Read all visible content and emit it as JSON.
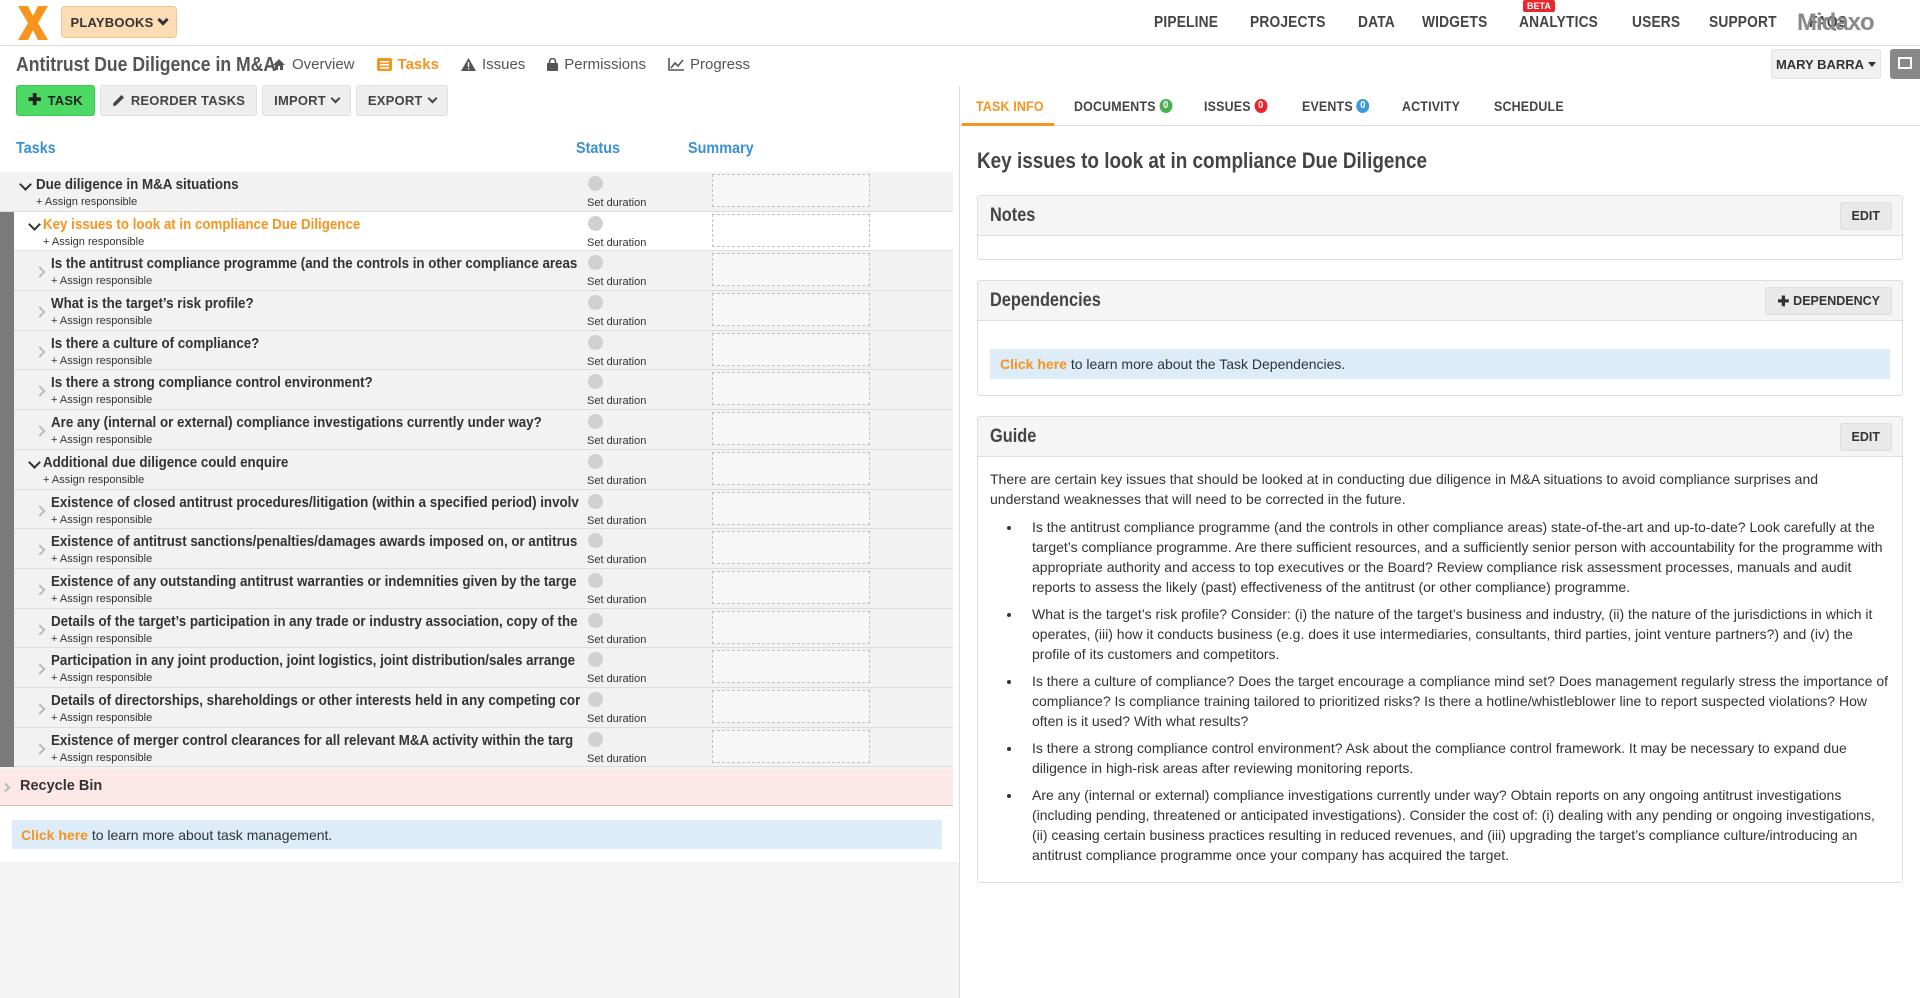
{
  "topnav": {
    "playbooks_label": "PLAYBOOKS",
    "links": [
      "PIPELINE",
      "PROJECTS",
      "DATA",
      "WIDGETS",
      "ANALYTICS",
      "USERS",
      "SUPPORT",
      "FAQS"
    ],
    "beta_label": "BETA",
    "brand": "Midaxo",
    "accent_color": "#f7941d"
  },
  "project": {
    "title": "Antitrust Due Diligence in M&A",
    "tabs": [
      {
        "label": "Overview",
        "icon": "home-icon"
      },
      {
        "label": "Tasks",
        "icon": "list-icon",
        "active": true
      },
      {
        "label": "Issues",
        "icon": "warning-icon"
      },
      {
        "label": "Permissions",
        "icon": "lock-icon"
      },
      {
        "label": "Progress",
        "icon": "line-chart-icon"
      }
    ],
    "user_label": "MARY BARRA"
  },
  "toolbar": {
    "task_label": "TASK",
    "reorder_label": "REORDER TASKS",
    "import_label": "IMPORT",
    "export_label": "EXPORT"
  },
  "table": {
    "col_tasks": "Tasks",
    "col_status": "Status",
    "col_summary": "Summary",
    "assign_label": "+ Assign responsible",
    "duration_label": "Set duration",
    "rows": [
      {
        "title": "Due diligence in M&A situations",
        "level": 0,
        "expanded": true
      },
      {
        "title": "Key issues to look at in compliance Due Diligence",
        "level": 1,
        "expanded": true,
        "selected": true
      },
      {
        "title": "Is the antitrust compliance programme (and the controls in other compliance areas",
        "level": 2
      },
      {
        "title": "What is the target’s risk profile?",
        "level": 2
      },
      {
        "title": "Is there a culture of compliance?",
        "level": 2
      },
      {
        "title": "Is there a strong compliance control environment?",
        "level": 2
      },
      {
        "title": "Are any (internal or external) compliance investigations currently under way?",
        "level": 2
      },
      {
        "title": "Additional due diligence could enquire",
        "level": 1,
        "expanded": true
      },
      {
        "title": "Existence of closed antitrust procedures/litigation (within a specified period) involv",
        "level": 2
      },
      {
        "title": "Existence of antitrust sanctions/penalties/damages awards imposed on, or antitrus",
        "level": 2
      },
      {
        "title": "Existence of any outstanding antitrust warranties or indemnities given by the targe",
        "level": 2
      },
      {
        "title": "Details of the target’s participation in any trade or industry association, copy of the",
        "level": 2
      },
      {
        "title": "Participation in any joint production, joint logistics, joint distribution/sales arrange",
        "level": 2
      },
      {
        "title": "Details of directorships, shareholdings or other interests held in any competing cor",
        "level": 2
      },
      {
        "title": "Existence of merger control clearances for all relevant M&A activity within the targ",
        "level": 2
      }
    ],
    "recycle_label": "Recycle Bin",
    "info_link": "Click here",
    "info_text": " to learn more about task management."
  },
  "right": {
    "tabs": [
      {
        "label": "TASK INFO",
        "active": true
      },
      {
        "label": "DOCUMENTS",
        "badge": "0",
        "badge_color": "#4cb050"
      },
      {
        "label": "ISSUES",
        "badge": "0",
        "badge_color": "#e8262b"
      },
      {
        "label": "EVENTS",
        "badge": "0",
        "badge_color": "#3b9ad9"
      },
      {
        "label": "ACTIVITY"
      },
      {
        "label": "SCHEDULE"
      }
    ],
    "title": "Key issues to look at in compliance Due Diligence",
    "notes_title": "Notes",
    "edit_label": "EDIT",
    "dependencies_title": "Dependencies",
    "dependency_btn": "DEPENDENCY",
    "dep_link": "Click here",
    "dep_text": " to learn more about the Task Dependencies.",
    "guide_title": "Guide",
    "guide_intro": "There are certain key issues that should be looked at in conducting due diligence in M&A situations to avoid compliance surprises and understand weaknesses that will need to be corrected in the future.",
    "guide_items": [
      "Is the antitrust compliance programme (and the controls in other compliance areas) state-of-the-art and up-to-date? Look carefully at the target’s compliance programme. Are there sufficient resources, and a sufficiently senior person with accountability for the programme with appropriate authority and access to top executives or the Board? Review compliance risk assessment processes, manuals and audit reports to assess the likely (past) effectiveness of the antitrust (or other compliance) programme.",
      "What is the target’s risk profile? Consider: (i) the nature of the target’s business and industry, (ii) the nature of the jurisdictions in which it operates, (iii) how it conducts business (e.g. does it use intermediaries, consultants, third parties, joint venture partners?) and (iv) the profile of its customers and competitors.",
      "Is there a culture of compliance? Does the target encourage a compliance mind set? Does management regularly stress the importance of compliance? Is compliance training tailored to prioritized risks? Is there a hotline/whistleblower line to report suspected violations? How often is it used? With what results?",
      "Is there a strong compliance control environment? Ask about the compliance control framework. It may be necessary to expand due diligence in high-risk areas after reviewing monitoring reports.",
      "Are any (internal or external) compliance investigations currently under way? Obtain reports on any ongoing antitrust investigations (including pending, threatened or anticipated investigations). Consider the cost of: (i) dealing with any pending or ongoing investigations, (ii) ceasing certain business practices resulting in reduced revenues, and (iii) upgrading the target’s compliance culture/introducing an antitrust compliance programme once your company has acquired the target."
    ]
  }
}
